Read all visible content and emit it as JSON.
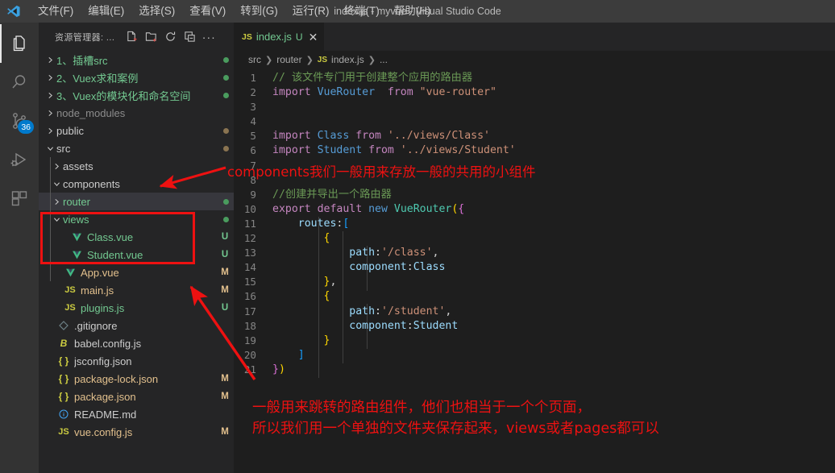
{
  "window": {
    "title": "index.js - myvue - Visual Studio Code",
    "logo_name": "vscode-logo"
  },
  "menubar": {
    "items": [
      {
        "label": "文件(F)",
        "name": "menu-file"
      },
      {
        "label": "编辑(E)",
        "name": "menu-edit"
      },
      {
        "label": "选择(S)",
        "name": "menu-selection"
      },
      {
        "label": "查看(V)",
        "name": "menu-view"
      },
      {
        "label": "转到(G)",
        "name": "menu-go"
      },
      {
        "label": "运行(R)",
        "name": "menu-run"
      },
      {
        "label": "终端(T)",
        "name": "menu-terminal"
      },
      {
        "label": "帮助(H)",
        "name": "menu-help"
      }
    ]
  },
  "activitybar": {
    "items": [
      {
        "name": "explorer-icon",
        "active": true,
        "badge": ""
      },
      {
        "name": "search-icon",
        "active": false,
        "badge": ""
      },
      {
        "name": "source-control-icon",
        "active": false,
        "badge": "36"
      },
      {
        "name": "run-debug-icon",
        "active": false,
        "badge": ""
      },
      {
        "name": "extensions-icon",
        "active": false,
        "badge": ""
      }
    ]
  },
  "sidebar": {
    "title": "资源管理器: ...",
    "actions": [
      {
        "name": "new-file-icon",
        "label": "新建文件"
      },
      {
        "name": "new-folder-icon",
        "label": "新建文件夹"
      },
      {
        "name": "refresh-icon",
        "label": "刷新"
      },
      {
        "name": "collapse-all-icon",
        "label": "全部折叠"
      },
      {
        "name": "more-actions-icon",
        "label": "..."
      }
    ],
    "tree": [
      {
        "label": "1、插槽src",
        "type": "folder",
        "expanded": false,
        "indent": 0,
        "color": "#73c991",
        "status": "",
        "dot": "#4a9c5e"
      },
      {
        "label": "2、Vuex求和案例",
        "type": "folder",
        "expanded": false,
        "indent": 0,
        "color": "#73c991",
        "status": "",
        "dot": "#4a9c5e"
      },
      {
        "label": "3、Vuex的模块化和命名空间",
        "type": "folder",
        "expanded": false,
        "indent": 0,
        "color": "#73c991",
        "status": "",
        "dot": "#4a9c5e"
      },
      {
        "label": "node_modules",
        "type": "folder",
        "expanded": false,
        "indent": 0,
        "color": "#8c8c8c",
        "status": "",
        "dot": ""
      },
      {
        "label": "public",
        "type": "folder",
        "expanded": false,
        "indent": 0,
        "color": "#cccccc",
        "status": "",
        "dot": "#8a7451"
      },
      {
        "label": "src",
        "type": "folder",
        "expanded": true,
        "indent": 0,
        "color": "#cccccc",
        "status": "",
        "dot": "#8a7451"
      },
      {
        "label": "assets",
        "type": "folder",
        "expanded": false,
        "indent": 1,
        "color": "#cccccc",
        "status": "",
        "dot": ""
      },
      {
        "label": "components",
        "type": "folder",
        "expanded": true,
        "indent": 1,
        "color": "#cccccc",
        "status": "",
        "dot": ""
      },
      {
        "label": "router",
        "type": "folder",
        "expanded": false,
        "indent": 1,
        "color": "#73c991",
        "status": "",
        "dot": "#4a9c5e",
        "selected": true
      },
      {
        "label": "views",
        "type": "folder",
        "expanded": true,
        "indent": 1,
        "color": "#73c991",
        "status": "",
        "dot": "#4a9c5e"
      },
      {
        "label": "Class.vue",
        "type": "vue",
        "indent": 2,
        "color": "#73c991",
        "status": "U",
        "statuscolor": "#73c991",
        "dot": ""
      },
      {
        "label": "Student.vue",
        "type": "vue",
        "indent": 2,
        "color": "#73c991",
        "status": "U",
        "statuscolor": "#73c991",
        "dot": ""
      },
      {
        "label": "App.vue",
        "type": "vue",
        "indent": 1,
        "color": "#e2c08d",
        "status": "M",
        "statuscolor": "#e2c08d",
        "dot": ""
      },
      {
        "label": "main.js",
        "type": "js",
        "indent": 1,
        "color": "#e2c08d",
        "status": "M",
        "statuscolor": "#e2c08d",
        "dot": ""
      },
      {
        "label": "plugins.js",
        "type": "js",
        "indent": 1,
        "color": "#73c991",
        "status": "U",
        "statuscolor": "#73c991",
        "dot": ""
      },
      {
        "label": ".gitignore",
        "type": "git",
        "indent": 0,
        "color": "#cccccc",
        "status": "",
        "dot": ""
      },
      {
        "label": "babel.config.js",
        "type": "babel",
        "indent": 0,
        "color": "#cccccc",
        "status": "",
        "dot": ""
      },
      {
        "label": "jsconfig.json",
        "type": "json",
        "indent": 0,
        "color": "#cccccc",
        "status": "",
        "dot": ""
      },
      {
        "label": "package-lock.json",
        "type": "json",
        "indent": 0,
        "color": "#e2c08d",
        "status": "M",
        "statuscolor": "#e2c08d",
        "dot": ""
      },
      {
        "label": "package.json",
        "type": "json",
        "indent": 0,
        "color": "#e2c08d",
        "status": "M",
        "statuscolor": "#e2c08d",
        "dot": ""
      },
      {
        "label": "README.md",
        "type": "md",
        "indent": 0,
        "color": "#cccccc",
        "status": "",
        "dot": ""
      },
      {
        "label": "vue.config.js",
        "type": "js",
        "indent": 0,
        "color": "#e2c08d",
        "status": "M",
        "statuscolor": "#e2c08d",
        "dot": ""
      }
    ]
  },
  "editor": {
    "tab": {
      "icon": "js-file-icon",
      "label": "index.js",
      "status": "U",
      "close": "✕"
    },
    "breadcrumbs": [
      "src",
      "router",
      "index.js",
      "..."
    ],
    "lines": [
      {
        "n": "1",
        "tokens": [
          {
            "t": "// 该文件专门用于创建整个应用的路由器",
            "c": "tk-com",
            "indent": 0
          }
        ]
      },
      {
        "n": "2",
        "tokens": [
          {
            "t": "import ",
            "c": "tk-key"
          },
          {
            "t": "VueRouter",
            "c": "tk-kw2"
          },
          {
            "t": "  from ",
            "c": "tk-key"
          },
          {
            "t": "\"vue-router\"",
            "c": "tk-str"
          }
        ]
      },
      {
        "n": "3",
        "tokens": []
      },
      {
        "n": "4",
        "tokens": []
      },
      {
        "n": "5",
        "tokens": [
          {
            "t": "import ",
            "c": "tk-key"
          },
          {
            "t": "Class",
            "c": "tk-kw2"
          },
          {
            "t": " from ",
            "c": "tk-key"
          },
          {
            "t": "'../views/Class'",
            "c": "tk-str"
          }
        ]
      },
      {
        "n": "6",
        "tokens": [
          {
            "t": "import ",
            "c": "tk-key"
          },
          {
            "t": "Student",
            "c": "tk-kw2"
          },
          {
            "t": " from ",
            "c": "tk-key"
          },
          {
            "t": "'../views/Student'",
            "c": "tk-str"
          }
        ]
      },
      {
        "n": "7",
        "tokens": []
      },
      {
        "n": "8",
        "tokens": []
      },
      {
        "n": "9",
        "tokens": [
          {
            "t": "//创建并导出一个路由器",
            "c": "tk-com"
          }
        ]
      },
      {
        "n": "10",
        "tokens": [
          {
            "t": "export ",
            "c": "tk-key"
          },
          {
            "t": "default ",
            "c": "tk-key"
          },
          {
            "t": "new ",
            "c": "tk-kw2"
          },
          {
            "t": "VueRouter",
            "c": "tk-cls"
          },
          {
            "t": "(",
            "c": "tk-br1"
          },
          {
            "t": "{",
            "c": "tk-br2"
          }
        ]
      },
      {
        "n": "11",
        "tokens": [
          {
            "t": "    ",
            "c": "tk-pun"
          },
          {
            "t": "routes",
            "c": "tk-id"
          },
          {
            "t": ":",
            "c": "tk-pun"
          },
          {
            "t": "[",
            "c": "tk-br3"
          }
        ]
      },
      {
        "n": "12",
        "tokens": [
          {
            "t": "        ",
            "c": "tk-pun"
          },
          {
            "t": "{",
            "c": "tk-br1"
          }
        ]
      },
      {
        "n": "13",
        "tokens": [
          {
            "t": "            ",
            "c": "tk-pun"
          },
          {
            "t": "path",
            "c": "tk-id"
          },
          {
            "t": ":",
            "c": "tk-pun"
          },
          {
            "t": "'/class'",
            "c": "tk-str"
          },
          {
            "t": ",",
            "c": "tk-pun"
          }
        ]
      },
      {
        "n": "14",
        "tokens": [
          {
            "t": "            ",
            "c": "tk-pun"
          },
          {
            "t": "component",
            "c": "tk-id"
          },
          {
            "t": ":",
            "c": "tk-pun"
          },
          {
            "t": "Class",
            "c": "tk-id"
          }
        ]
      },
      {
        "n": "15",
        "tokens": [
          {
            "t": "        ",
            "c": "tk-pun"
          },
          {
            "t": "}",
            "c": "tk-br1"
          },
          {
            "t": ",",
            "c": "tk-pun"
          }
        ]
      },
      {
        "n": "16",
        "tokens": [
          {
            "t": "        ",
            "c": "tk-pun"
          },
          {
            "t": "{",
            "c": "tk-br1"
          }
        ]
      },
      {
        "n": "17",
        "tokens": [
          {
            "t": "            ",
            "c": "tk-pun"
          },
          {
            "t": "path",
            "c": "tk-id"
          },
          {
            "t": ":",
            "c": "tk-pun"
          },
          {
            "t": "'/student'",
            "c": "tk-str"
          },
          {
            "t": ",",
            "c": "tk-pun"
          }
        ]
      },
      {
        "n": "18",
        "tokens": [
          {
            "t": "            ",
            "c": "tk-pun"
          },
          {
            "t": "component",
            "c": "tk-id"
          },
          {
            "t": ":",
            "c": "tk-pun"
          },
          {
            "t": "Student",
            "c": "tk-id"
          }
        ]
      },
      {
        "n": "19",
        "tokens": [
          {
            "t": "        ",
            "c": "tk-pun"
          },
          {
            "t": "}",
            "c": "tk-br1"
          }
        ]
      },
      {
        "n": "20",
        "tokens": [
          {
            "t": "    ",
            "c": "tk-pun"
          },
          {
            "t": "]",
            "c": "tk-br3"
          }
        ]
      },
      {
        "n": "21",
        "tokens": [
          {
            "t": "}",
            "c": "tk-br2"
          },
          {
            "t": ")",
            "c": "tk-br1"
          }
        ]
      }
    ]
  },
  "annotations": {
    "color": "#ee1111",
    "note_components": "components我们一般用来存放一般的共用的小组件",
    "note_views_line1": "一般用来跳转的路由组件，他们也相当于一个个页面，",
    "note_views_line2": "所以我们用一个单独的文件夹保存起来，views或者pages都可以"
  }
}
